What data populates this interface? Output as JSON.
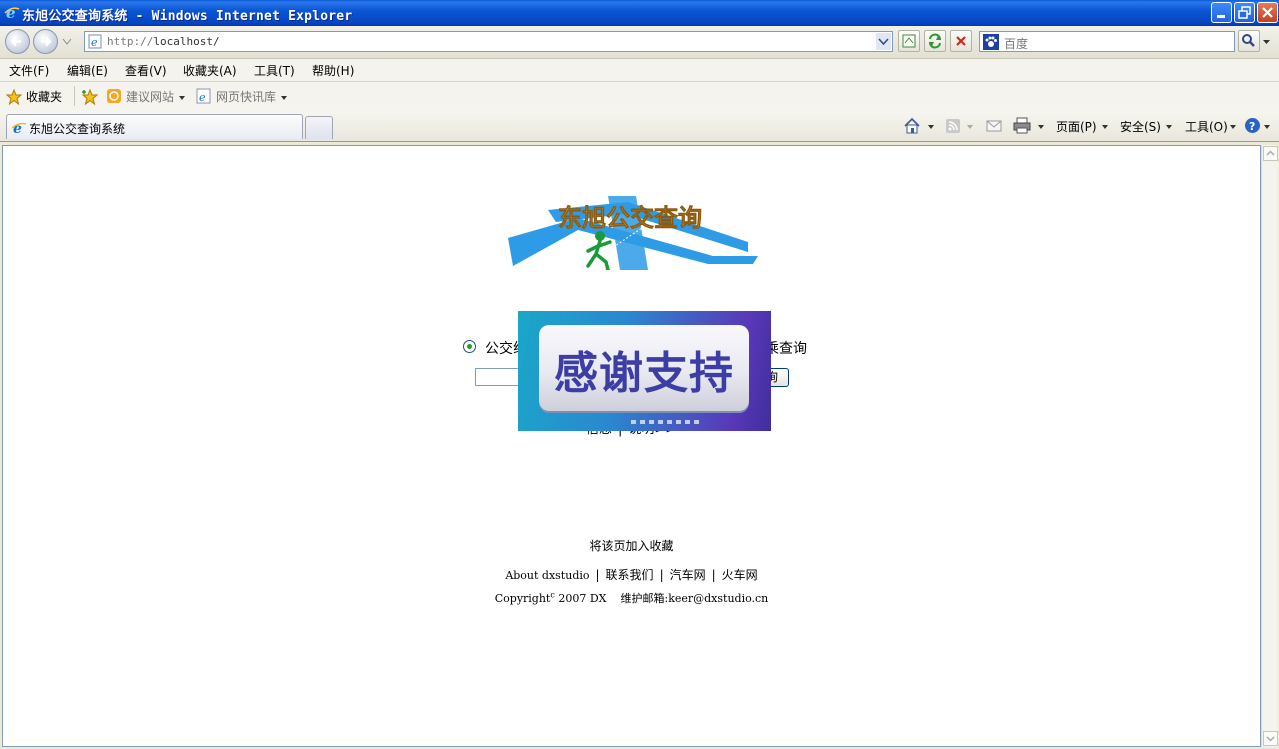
{
  "window": {
    "title": "东旭公交查询系统 - Windows Internet Explorer"
  },
  "address": {
    "protocol": "http://",
    "host": "localhost/"
  },
  "search": {
    "placeholder": "百度"
  },
  "menu": [
    "文件(F)",
    "编辑(E)",
    "查看(V)",
    "收藏夹(A)",
    "工具(T)",
    "帮助(H)"
  ],
  "favorites": {
    "label": "收藏夹",
    "suggested": "建议网站",
    "webslice": "网页快讯库"
  },
  "tab": {
    "title": "东旭公交查询系统"
  },
  "commandbar": {
    "page": "页面(P)",
    "safety": "安全(S)",
    "tools": "工具(O)"
  },
  "page": {
    "logo_text": "东旭公交查询",
    "radio_left": "公交线",
    "radio_right": "乘查询",
    "query_button": "询",
    "info_left": "信息",
    "info_right": "说明>>",
    "banner_text": "感谢支持",
    "add_favorite": "将该页加入收藏",
    "links": [
      "About dxstudio",
      "联系我们",
      "汽车网",
      "火车网"
    ],
    "copyright_prefix": "Copyright",
    "copyright_mark": "c",
    "copyright_rest": " 2007 DX",
    "maintainer": "维护邮箱:keer@dxstudio.cn"
  },
  "colors": {
    "title_bar": "#0a56d4",
    "banner_left": "#1aa7c9",
    "banner_right": "#5a38b8",
    "banner_text": "#3d3da6"
  }
}
